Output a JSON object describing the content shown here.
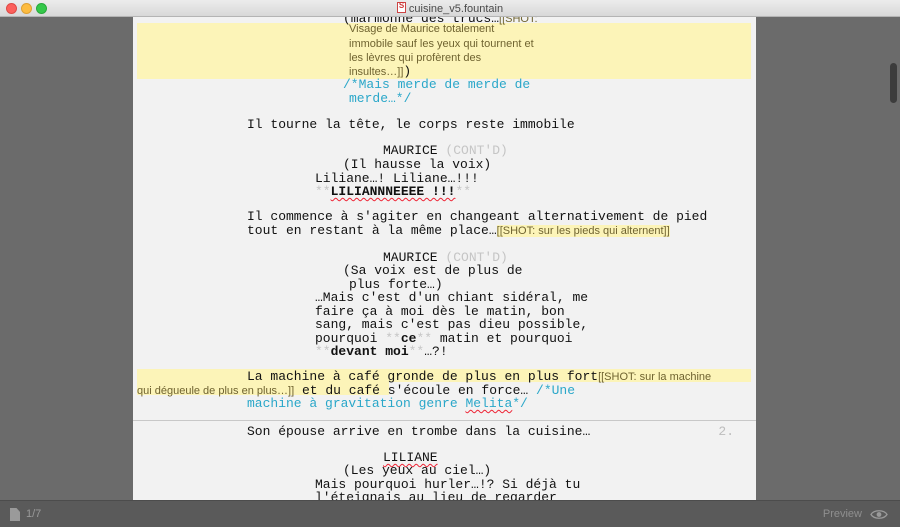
{
  "window": {
    "title": "cuisine_v5.fountain"
  },
  "script": {
    "l_marmonne": "(marmonne des trucs…",
    "note_visage_1": "[[SHOT:",
    "note_visage_2": "Visage de Maurice totalement",
    "note_visage_3": "immobile sauf les yeux qui tournent et",
    "note_visage_4": "les lèvres qui profèrent des",
    "note_visage_5": "insultes…]]",
    "close_paren": ")",
    "comment_merde_1": "/*Mais merde de merde de",
    "comment_merde_2": "merde…*/",
    "action_tete": "Il tourne la tête, le corps reste immobile",
    "char_maurice": "MAURICE",
    "contd": "(CONT'D)",
    "paren_hausse": "(Il hausse la voix)",
    "dial_liliane": "Liliane…! Liliane…!!!",
    "bold_marker": "**",
    "dial_lilianneeee": "LILIANNNEEEE !!!",
    "action_agiter_1": "Il commence à s'agiter en changeant alternativement de pied",
    "action_agiter_2": "tout en restant à la même place…",
    "note_pieds": "[[SHOT: sur les pieds qui alternent]]",
    "paren_voix_1": "(Sa voix est de plus de",
    "paren_voix_2": "plus forte…)",
    "dial_chiant_1": "…Mais c'est d'un chiant sidéral, me",
    "dial_chiant_2": "faire ça à moi dès le matin, bon",
    "dial_chiant_3": "sang, mais c'est pas dieu possible,",
    "dial_pourquoi_a": "pourquoi ",
    "dial_ce": "ce",
    "dial_pourquoi_b": " matin et pourquoi",
    "dial_devant": "devant moi",
    "dial_end": "…?!",
    "action_machine_1": "La machine à café gronde de plus en plus fort",
    "note_machine_1": "[[SHOT: sur la machine",
    "note_machine_2": "qui dégueule de plus en plus…]]",
    "action_machine_2": " et du café s'écoule en force… ",
    "comment_une": "/*Une",
    "comment_machine_a": "machine à gravitation genre ",
    "comment_melita": "Melita",
    "comment_machine_b": "*/",
    "page_number": "2.",
    "action_epouse": "Son épouse arrive en trombe dans la cuisine…",
    "char_liliane": "LILIANE",
    "paren_yeux": "(Les yeux au ciel…)",
    "dial_hurler_1": "Mais pourquoi hurler…!? Si déjà tu",
    "dial_hurler_2": "l'éteignais au lieu de regarder"
  },
  "status": {
    "page_count": "1/7",
    "preview_label": "Preview"
  },
  "colors": {
    "note_highlight": "#fcf4b8",
    "comment": "#2aa7c9",
    "contd": "#c5c5c5"
  }
}
